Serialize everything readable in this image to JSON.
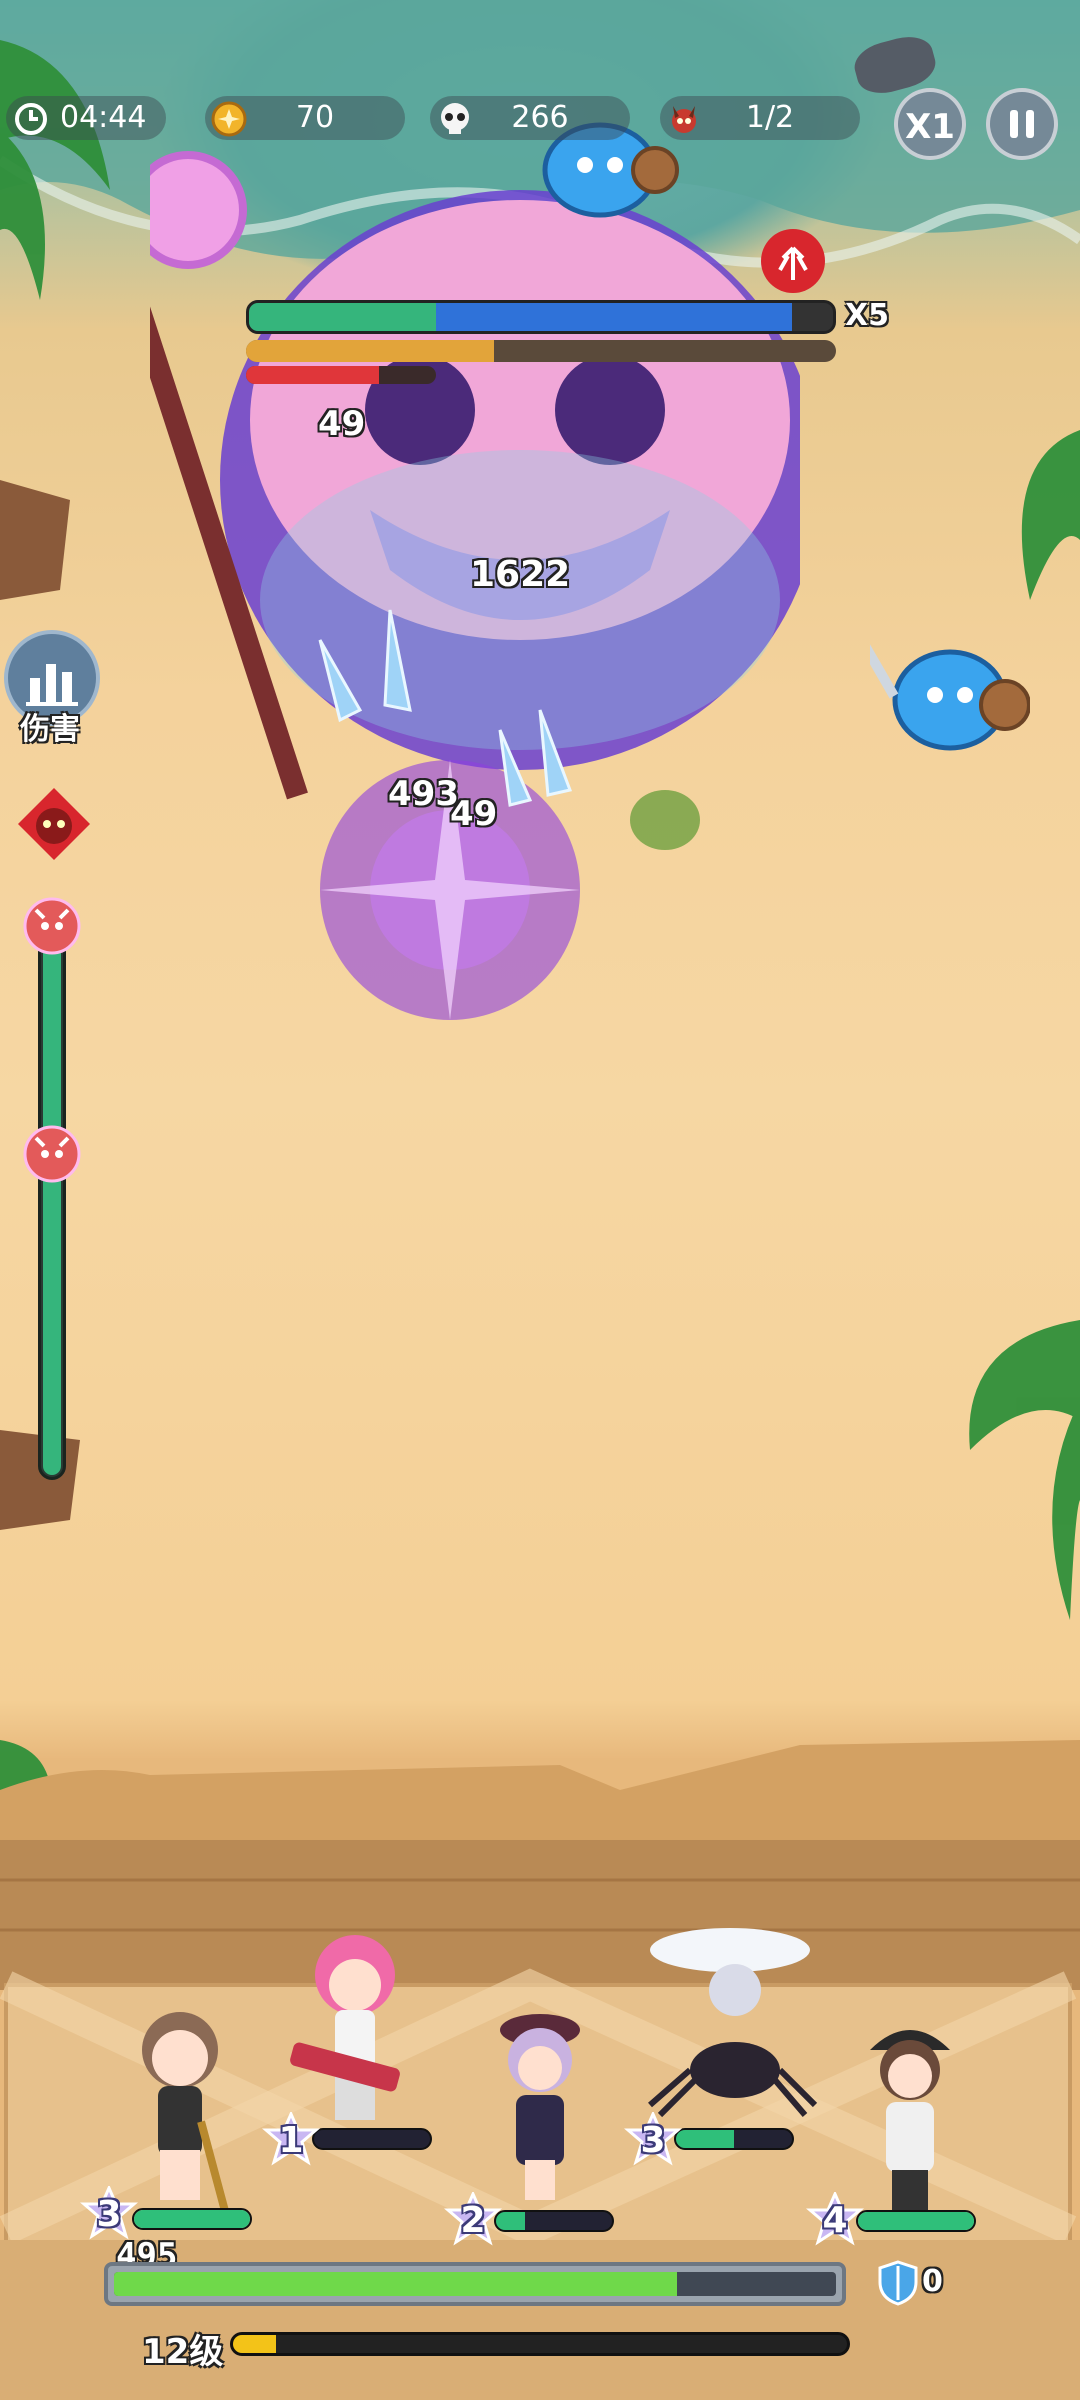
{
  "hud": {
    "timer": "04:44",
    "coins": "70",
    "kills": "266",
    "wave": "1/2",
    "speed_label": "X1",
    "icons": {
      "timer": "clock-icon",
      "coins": "coin-icon",
      "kills": "skull-icon",
      "wave": "demon-icon",
      "pause": "pause-icon"
    }
  },
  "boss": {
    "multiplier": "X5",
    "hp_fraction": 0.93,
    "shield_fraction": 0.42,
    "rage_fraction": 0.7,
    "buff_icon": "arrow-buff-icon"
  },
  "damage_numbers": [
    "49",
    "1622",
    "493",
    "49"
  ],
  "side": {
    "damage_label": "伤害",
    "damage_icon": "bar-chart-icon",
    "skull_icon": "demon-mask-icon",
    "progress_markers": 2
  },
  "heroes": [
    {
      "name_icon": "staff-girl",
      "star": "3",
      "hp_fraction": 1.0
    },
    {
      "name_icon": "gunner-girl",
      "star": "1",
      "hp_fraction": 0.0
    },
    {
      "name_icon": "witch-girl",
      "star": "2",
      "hp_fraction": 0.25
    },
    {
      "name_icon": "spider-rider",
      "star": "3",
      "hp_fraction": 0.5
    },
    {
      "name_icon": "cap-girl",
      "star": "4",
      "hp_fraction": 1.0
    }
  ],
  "base": {
    "hp_value": "495",
    "hp_fraction": 0.78,
    "shield_value": "0",
    "level_label": "12级",
    "xp_fraction": 0.07
  },
  "colors": {
    "boss_hp": "#2f72d9",
    "boss_hp_green": "#35b57c",
    "boss_shield": "#e2a43a",
    "rage": "#e0363a",
    "base_hp": "#6fd94a",
    "xp": "#f3c318"
  }
}
